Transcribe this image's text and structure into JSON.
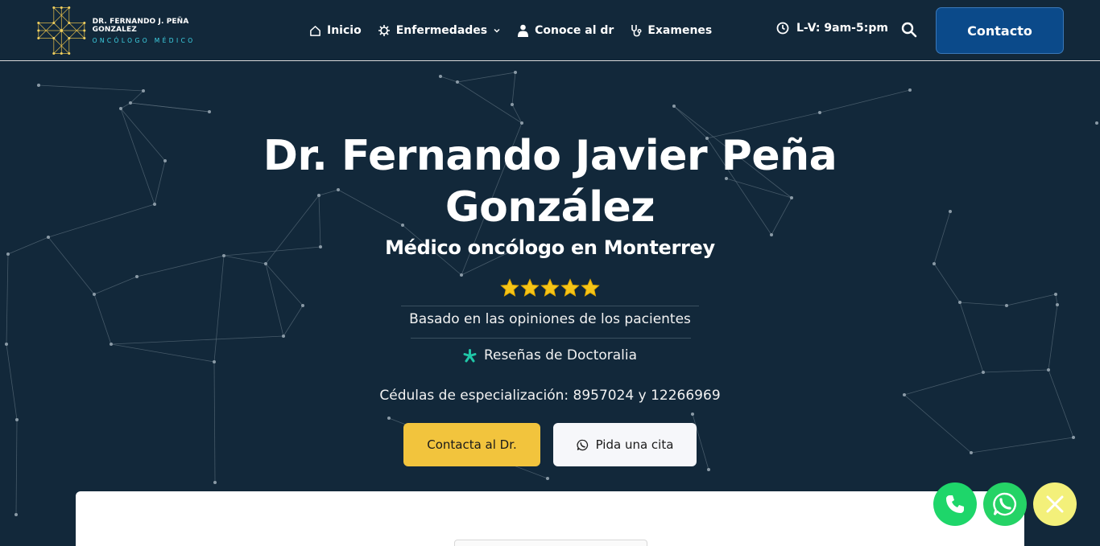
{
  "brand": {
    "name": "DR. FERNANDO J. PEÑA GONZALEZ",
    "tagline": "ONCÓLOGO MÉDICO",
    "accent_color": "#3fd6e8",
    "logo_icon": "network-cross-logo"
  },
  "nav": {
    "items": [
      {
        "label": "Inicio",
        "icon": "home-icon"
      },
      {
        "label": "Enfermedades",
        "icon": "virus-icon",
        "has_dropdown": true
      },
      {
        "label": "Conoce al dr",
        "icon": "doctor-icon"
      },
      {
        "label": "Examenes",
        "icon": "stethoscope-icon"
      }
    ],
    "hours": "L-V: 9am-5:pm",
    "contact_label": "Contacto"
  },
  "hero": {
    "title_line1": "Dr. Fernando Javier Peña",
    "title_line2": "González",
    "subtitle": "Médico oncólogo en Monterrey",
    "rating_stars": 5,
    "opinions_text": "Basado en las opiniones de los pacientes",
    "reviews_text": "Reseñas de Doctoralia",
    "cedulas_text": "Cédulas de especialización: 8957024 y 12266969",
    "cta_primary": "Contacta al Dr.",
    "cta_secondary": "Pida una cita"
  },
  "colors": {
    "background": "#12283a",
    "primary_button": "#0b4a8a",
    "cta_yellow": "#f2c43d",
    "star": "#f5c518",
    "doctoralia": "#20c7a8",
    "phone_fab": "#1ed66a",
    "whatsapp_fab": "#25d366",
    "close_fab": "#f3f07a"
  },
  "floating_actions": [
    {
      "icon": "phone-icon"
    },
    {
      "icon": "whatsapp-icon"
    },
    {
      "icon": "close-icon"
    }
  ]
}
